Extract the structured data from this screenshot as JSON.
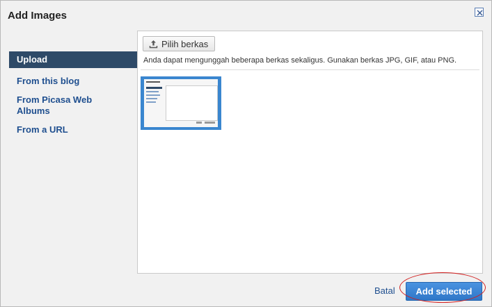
{
  "dialog": {
    "title": "Add Images",
    "close_icon": "close-icon"
  },
  "sidebar": {
    "items": [
      {
        "label": "Upload",
        "active": true
      },
      {
        "label": "From this blog",
        "active": false
      },
      {
        "label": "From Picasa Web Albums",
        "active": false
      },
      {
        "label": "From a URL",
        "active": false
      }
    ]
  },
  "upload": {
    "button_label": "Pilih berkas",
    "button_icon": "upload-icon",
    "hint": "Anda dapat mengunggah beberapa berkas sekaligus. Gunakan berkas JPG, GIF, atau PNG."
  },
  "footer": {
    "cancel_label": "Batal",
    "add_label": "Add selected"
  },
  "colors": {
    "accent": "#2f77c8",
    "sidebar_active": "#2e4a68",
    "link": "#1f4f8f",
    "annotation": "#d21e1e"
  }
}
